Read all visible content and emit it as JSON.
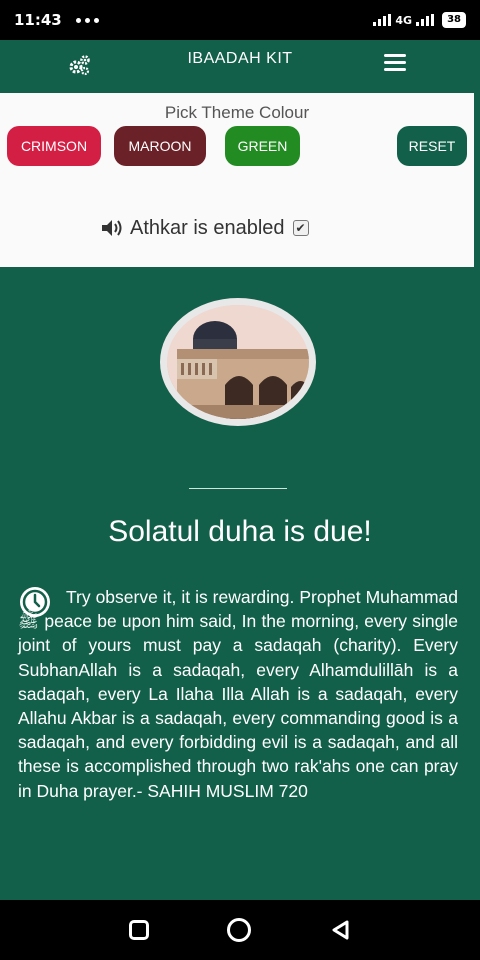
{
  "status_bar": {
    "time": "11:43",
    "network": "4G",
    "battery": "38"
  },
  "header": {
    "title": "IBAADAH KIT",
    "left_icon": "gear-icon",
    "right_icon": "menu-icon"
  },
  "theme_panel": {
    "label": "Pick Theme Colour",
    "buttons": [
      {
        "label": "CRIMSON",
        "color": "#d41f45"
      },
      {
        "label": "MAROON",
        "color": "#6a2127"
      },
      {
        "label": "GREEN",
        "color": "#228b22"
      },
      {
        "label": "RESET",
        "color": "#13604a"
      }
    ],
    "athkar_label": "Athkar is enabled",
    "athkar_checked": true
  },
  "main": {
    "headline": "Solatul duha is due!",
    "body": "Try observe it, it is rewarding. Prophet Muhammad ﷺ peace be upon him said, In the morning, every single joint of yours must pay a sadaqah (charity). Every SubhanAllah is a sadaqah, every Alhamdulillāh is a sadaqah, every La Ilaha Illa Allah is a sadaqah, every Allahu Akbar is a sadaqah, every commanding good is a sadaqah, and every forbidding evil is a sadaqah, and all these is accomplished through two rak'ahs one can pray in Duha prayer.- SAHIH MUSLIM 720"
  },
  "colors": {
    "primary": "#13604a",
    "panel": "#fafafa"
  }
}
